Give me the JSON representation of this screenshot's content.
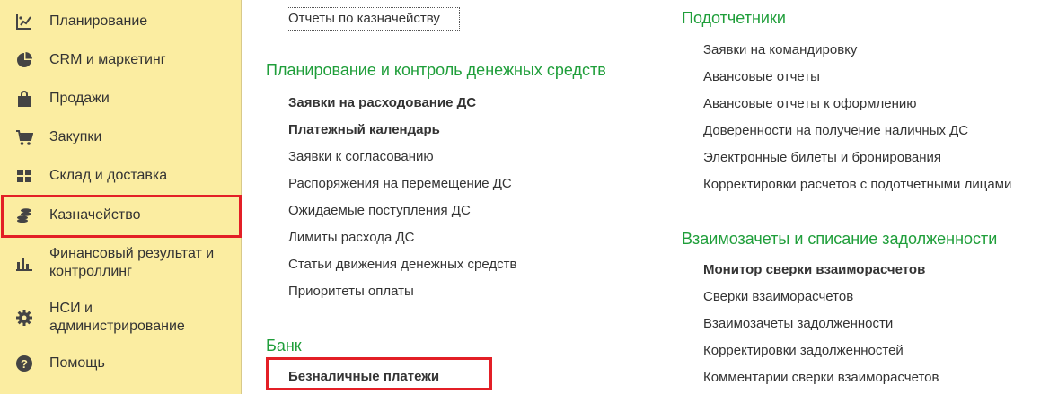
{
  "sidebar": {
    "items": [
      {
        "label": "Планирование",
        "icon": "planning-icon"
      },
      {
        "label": "CRM и маркетинг",
        "icon": "pie-chart-icon"
      },
      {
        "label": "Продажи",
        "icon": "shopping-bag-icon"
      },
      {
        "label": "Закупки",
        "icon": "cart-icon"
      },
      {
        "label": "Склад и доставка",
        "icon": "warehouse-grid-icon"
      },
      {
        "label": "Казначейство",
        "icon": "coins-icon"
      },
      {
        "label": "Финансовый результат и контроллинг",
        "icon": "bar-chart-icon"
      },
      {
        "label": "НСИ и администрирование",
        "icon": "gear-icon"
      },
      {
        "label": "Помощь",
        "icon": "help-icon"
      }
    ]
  },
  "main": {
    "top_link": "Отчеты по казначейству",
    "planning": {
      "title": "Планирование и контроль денежных средств",
      "links": [
        "Заявки на расходование ДС",
        "Платежный календарь",
        "Заявки к согласованию",
        "Распоряжения на перемещение ДС",
        "Ожидаемые поступления ДС",
        "Лимиты расхода ДС",
        "Статьи движения денежных средств",
        "Приоритеты оплаты"
      ]
    },
    "bank": {
      "title": "Банк",
      "links": [
        "Безналичные платежи"
      ]
    },
    "accountable": {
      "title": "Подотчетники",
      "links": [
        "Заявки на командировку",
        "Авансовые отчеты",
        "Авансовые отчеты к оформлению",
        "Доверенности на получение наличных ДС",
        "Электронные билеты и бронирования",
        "Корректировки расчетов с подотчетными лицами"
      ]
    },
    "offsets": {
      "title": "Взаимозачеты и списание задолженности",
      "links": [
        "Монитор сверки взаиморасчетов",
        "Сверки взаиморасчетов",
        "Взаимозачеты задолженности",
        "Корректировки задолженностей",
        "Комментарии сверки взаиморасчетов"
      ]
    }
  },
  "colors": {
    "sidebar_bg": "#fbeda1",
    "section_title": "#1f9e3a",
    "highlight": "#e31f26"
  }
}
